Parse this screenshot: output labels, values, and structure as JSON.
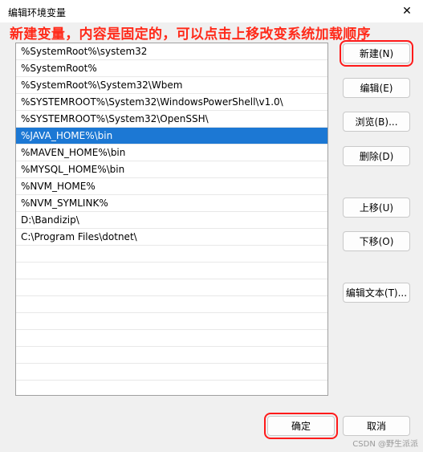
{
  "window": {
    "title": "编辑环境变量",
    "close_glyph": "✕"
  },
  "annotation": "新建变量，内容是固定的，可以点击上移改变系统加载顺序",
  "list": {
    "items": [
      "%SystemRoot%\\system32",
      "%SystemRoot%",
      "%SystemRoot%\\System32\\Wbem",
      "%SYSTEMROOT%\\System32\\WindowsPowerShell\\v1.0\\",
      "%SYSTEMROOT%\\System32\\OpenSSH\\",
      "%JAVA_HOME%\\bin",
      "%MAVEN_HOME%\\bin",
      "%MYSQL_HOME%\\bin",
      "%NVM_HOME%",
      "%NVM_SYMLINK%",
      "D:\\Bandizip\\",
      "C:\\Program Files\\dotnet\\",
      "",
      "",
      "",
      "",
      "",
      "",
      "",
      "",
      ""
    ],
    "selected_index": 5
  },
  "buttons": {
    "new": "新建(N)",
    "edit": "编辑(E)",
    "browse": "浏览(B)...",
    "delete": "删除(D)",
    "move_up": "上移(U)",
    "move_down": "下移(O)",
    "edit_text": "编辑文本(T)...",
    "ok": "确定",
    "cancel": "取消"
  },
  "watermark": "CSDN @野生派派",
  "colors": {
    "annotation": "#ff2a1a",
    "selection": "#1c78d4",
    "highlight_box": "#ff1a1a"
  }
}
